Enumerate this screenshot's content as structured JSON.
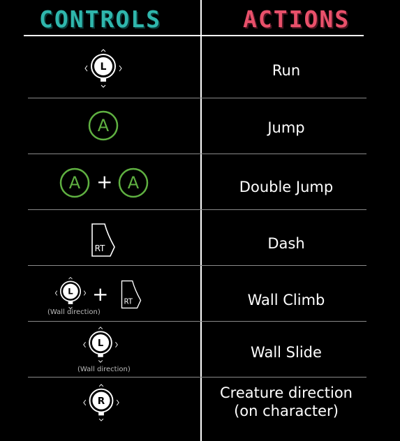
{
  "headers": {
    "controls": "CONTROLS",
    "actions": "ACTIONS"
  },
  "rows": [
    {
      "action": "Run",
      "stick": "L"
    },
    {
      "action": "Jump",
      "button": "A"
    },
    {
      "action": "Double Jump",
      "button": "A",
      "plus": "+"
    },
    {
      "action": "Dash",
      "trigger": "RT"
    },
    {
      "action": "Wall Climb",
      "stick": "L",
      "trigger": "RT",
      "plus": "+",
      "caption": "(Wall direction)"
    },
    {
      "action": "Wall Slide",
      "stick": "L",
      "caption": "(Wall direction)"
    },
    {
      "action_lines": [
        "Creature direction",
        "(on character)"
      ],
      "stick": "R"
    }
  ],
  "colors": {
    "controls_header": "#2fb6ac",
    "actions_header": "#e8506a",
    "button_green": "#5fb041"
  },
  "icons": [
    "left-stick-icon",
    "a-button-icon",
    "rt-trigger-icon",
    "right-stick-icon"
  ]
}
